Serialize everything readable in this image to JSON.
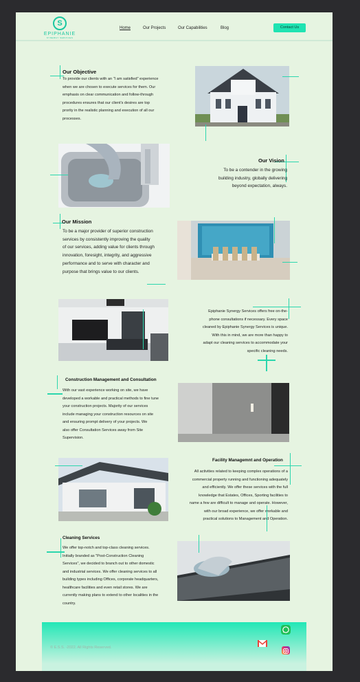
{
  "brand": {
    "name": "EPIPHANIE",
    "subtitle": "SYNERGY SERVICES",
    "mark": "S"
  },
  "nav": [
    {
      "label": "Home",
      "active": true
    },
    {
      "label": "Our Projects"
    },
    {
      "label": "Our Capabilities"
    },
    {
      "label": "Blog"
    }
  ],
  "contact_label": "Contact Us",
  "sections": {
    "objective": {
      "title": "Our Objective",
      "lines": [
        "To provide our clients with an \"I am satisfied\" experience",
        "when we are chosen to execute services for them. Our",
        "emphasis on clear communication and follow-through",
        "procedures ensures that our client's  desires are top",
        "prority in the realistic planning and execution of all our",
        "processes."
      ]
    },
    "vision": {
      "title": "Our Vision",
      "lines": [
        "To be a contender in the growing",
        "building industry, globally delivering",
        "beyond expectation, always."
      ]
    },
    "mission": {
      "title": "Our Mission",
      "lines": [
        "To be a major provider of superior construction",
        "services by consistently improving the quality",
        "of our services, adding value for clients through",
        "innovation, foresight, integrity, and aggressive",
        "performance and to serve with character and",
        "purpose that brings value to our clients."
      ]
    },
    "phone": {
      "lines": [
        "Epiphanie Synergy Services offers free on-the-",
        "phone consultations if necessary. Every space",
        "cleaned by Epiphanie Synergy Services is unique.",
        "With this in mind, we are more than happy to",
        "adapt our cleaning services to accommodate your",
        "specific cleaning needs."
      ]
    },
    "construction": {
      "title": "Construction Management and Consultation",
      "lines": [
        "With our vast experience working on site, we have",
        "developed a workable and practical methods to fine tune",
        "your construction projects. Majority of our services",
        "include managing your construction resources on site",
        "and ensuring prompt delivery of your projects. We",
        "also offer Consultation Services away from Site",
        "Supervision."
      ]
    },
    "facility": {
      "title": "Facility Managemnt and Operation",
      "lines": [
        "All activities related to keeping complex operations of a",
        "commercial property running and functioning adequately",
        "and efficiently. We offer these services with the full",
        "knowledge that Estates, Offices, Sporting facilities to",
        "name a few are difficult to manage and operate. However,",
        "with our broad experience, we offer workable and",
        "practical solutions to Management and Operation."
      ]
    },
    "cleaning": {
      "title": "Cleaning Services",
      "lines": [
        "We offer top-notch and top-class cleaning services.",
        "Initially branded as \"Post-Construction Cleaning",
        "Services\", we decided to branch out to other domestic",
        "and industrial services. We offer cleaning services to all",
        "building types including Offices, corporate headquarters,",
        "healthcare facilities and even retail stores. We are",
        "currently making plans to extend to other localities in the",
        "country."
      ]
    }
  },
  "footer": {
    "copyright": "© E.S.S. -2022. All Rights Reserved."
  },
  "colors": {
    "accent": "#1fe3b2",
    "background": "#e6f4e1",
    "frame": "#2b2b2e"
  },
  "icons": [
    "whatsapp-icon",
    "gmail-icon",
    "instagram-icon"
  ]
}
